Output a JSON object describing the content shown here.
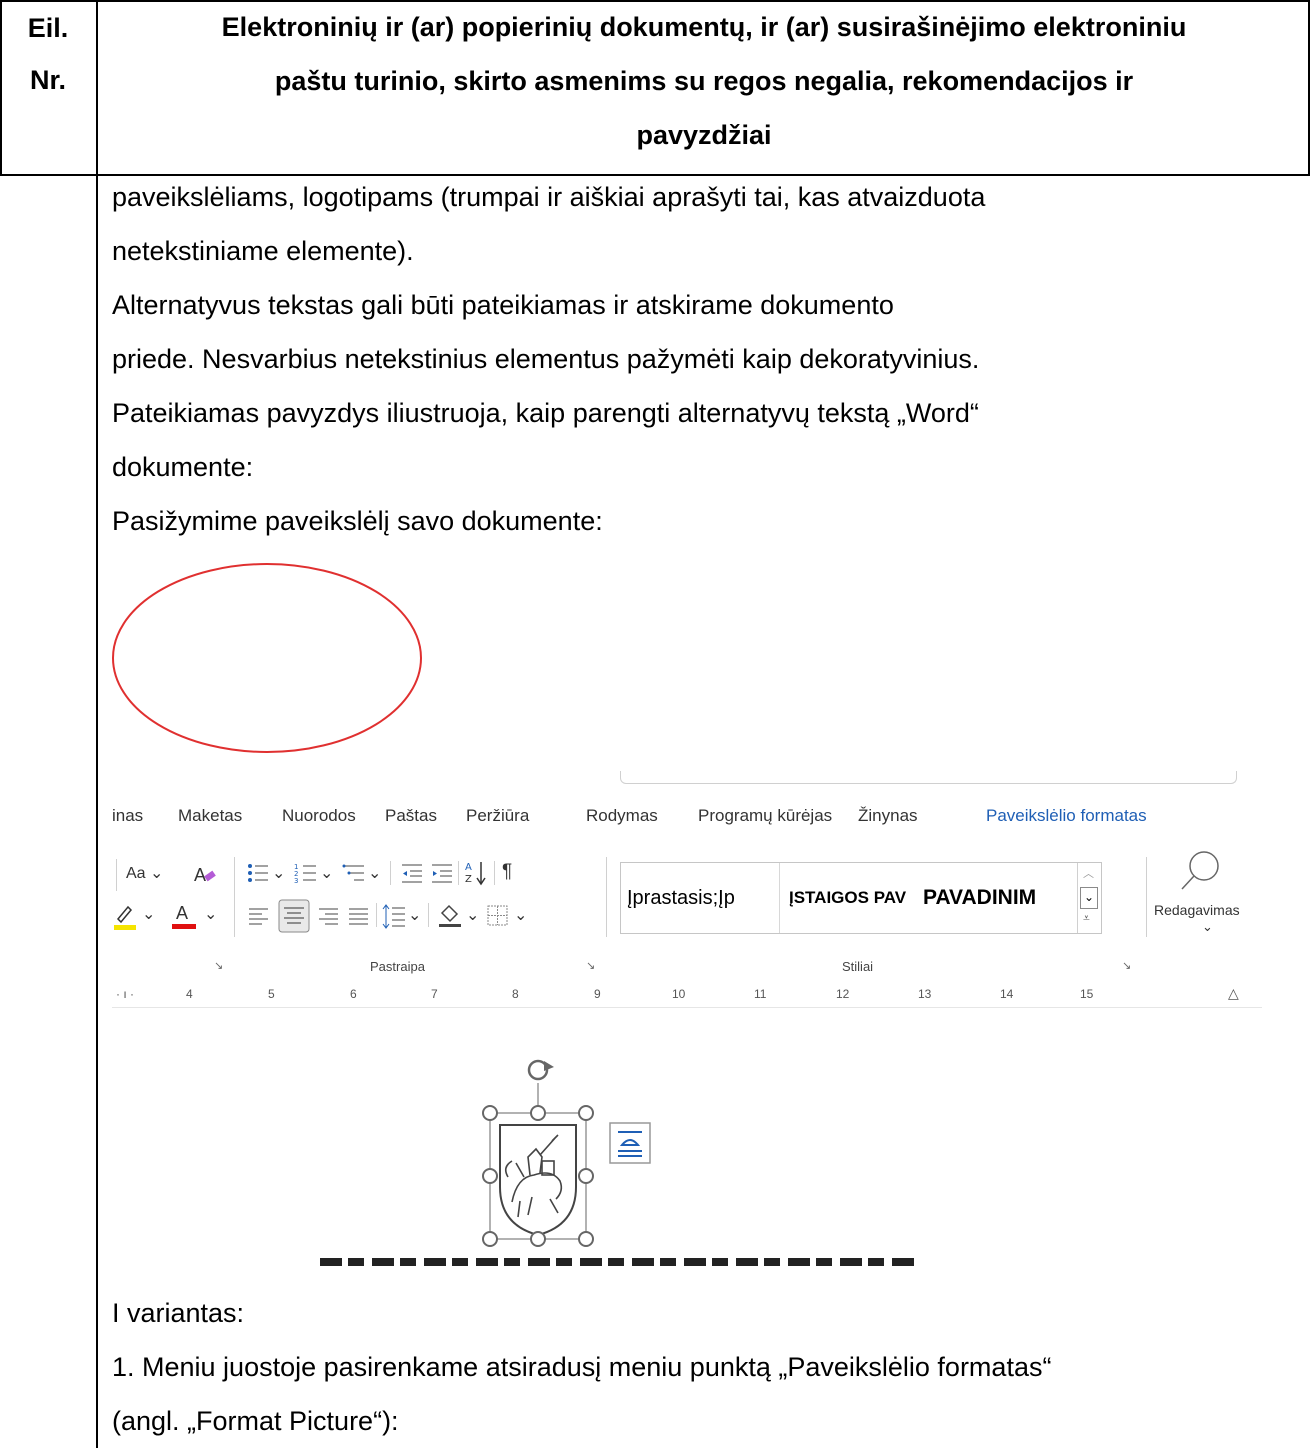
{
  "header": {
    "num_label_line1": "Eil.",
    "num_label_line2": "Nr.",
    "title_line1": "Elektroninių ir (ar) popierinių dokumentų, ir (ar) susirašinėjimo elektroniniu",
    "title_line2": "paštu turinio, skirto asmenims su regos negalia, rekomendacijos ir",
    "title_line3": "pavyzdžiai"
  },
  "body": {
    "line1": "paveikslėliams, logotipams (trumpai ir aiškiai aprašyti tai, kas atvaizduota",
    "line2": "netekstiniame elemente).",
    "line3": "Alternatyvus tekstas gali būti pateikiamas ir atskirame dokumento",
    "line4": "priede. Nesvarbius netekstinius elementus pažymėti kaip dekoratyvinius.",
    "line5": "Pateikiamas pavyzdys iliustruoja, kaip parengti alternatyvų tekstą „Word“",
    "line6": "dokumente:",
    "line7": "Pasižymime paveikslėlį savo dokumente:",
    "line8": "I variantas:",
    "line9": "1. Meniu juostoje pasirenkame atsiradusį meniu punktą „Paveikslėlio formatas“",
    "line10": "(angl. „Format Picture“):"
  },
  "word": {
    "tabs": [
      "inas",
      "Maketas",
      "Nuorodos",
      "Paštas",
      "Peržiūra",
      "Rodymas",
      "Programų kūrėjas",
      "Žinynas",
      "Paveikslėlio formatas"
    ],
    "font_case_label": "Aa",
    "styles": [
      "Įprastasis;Įp",
      "ĮSTAIGOS PAV",
      "PAVADINIM"
    ],
    "editing_label": "Redagavimas",
    "group_paragraph": "Pastraipa",
    "group_styles": "Stiliai",
    "ruler_numbers": [
      "4",
      "5",
      "6",
      "7",
      "8",
      "9",
      "10",
      "11",
      "12",
      "13",
      "14",
      "15"
    ]
  },
  "colors": {
    "oval": "#e03030",
    "active_tab": "#1f5fb5",
    "highlight": "#f5e400",
    "font_color": "#e01010"
  }
}
